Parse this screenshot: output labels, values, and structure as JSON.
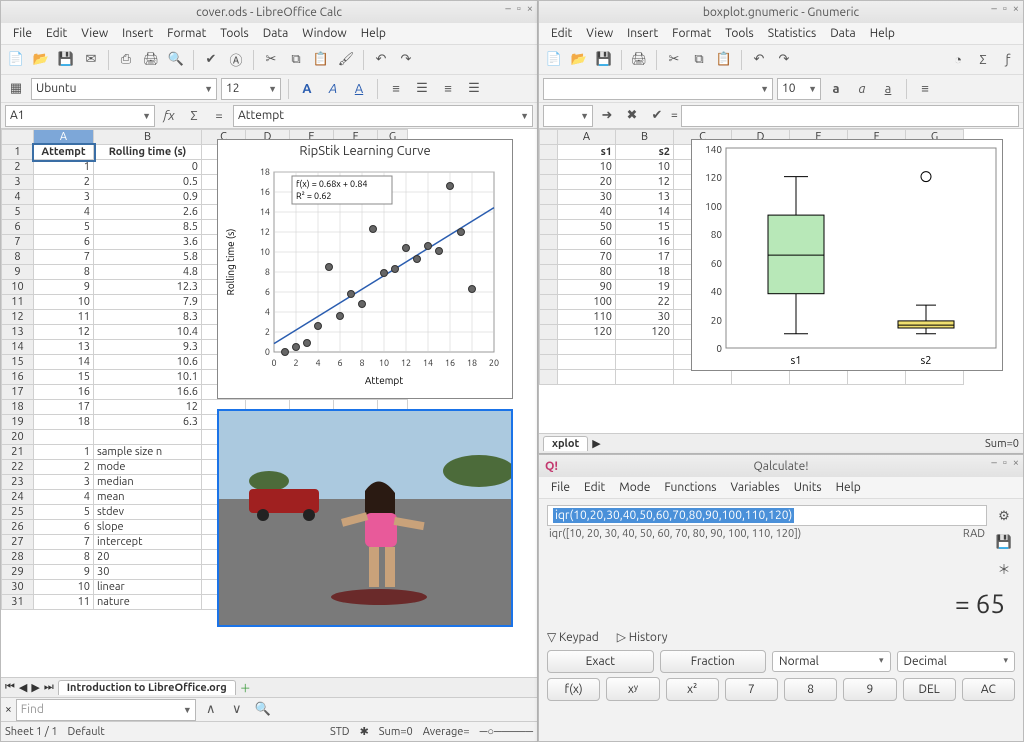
{
  "calc": {
    "title": "cover.ods - LibreOffice Calc",
    "menus": [
      "File",
      "Edit",
      "View",
      "Insert",
      "Format",
      "Tools",
      "Data",
      "Window",
      "Help"
    ],
    "font": "Ubuntu",
    "fontsize": "12",
    "cellref": "A1",
    "cellvalue": "Attempt",
    "cols": [
      "A",
      "B",
      "C",
      "D",
      "E",
      "F",
      "G"
    ],
    "headers": {
      "A": "Attempt",
      "B": "Rolling time (s)"
    },
    "rows": [
      {
        "n": 1,
        "a": "Attempt",
        "b": "Rolling time (s)"
      },
      {
        "n": 2,
        "a": "1",
        "b": "0"
      },
      {
        "n": 3,
        "a": "2",
        "b": "0.5"
      },
      {
        "n": 4,
        "a": "3",
        "b": "0.9"
      },
      {
        "n": 5,
        "a": "4",
        "b": "2.6"
      },
      {
        "n": 6,
        "a": "5",
        "b": "8.5"
      },
      {
        "n": 7,
        "a": "6",
        "b": "3.6"
      },
      {
        "n": 8,
        "a": "7",
        "b": "5.8"
      },
      {
        "n": 9,
        "a": "8",
        "b": "4.8"
      },
      {
        "n": 10,
        "a": "9",
        "b": "12.3"
      },
      {
        "n": 11,
        "a": "10",
        "b": "7.9"
      },
      {
        "n": 12,
        "a": "11",
        "b": "8.3"
      },
      {
        "n": 13,
        "a": "12",
        "b": "10.4"
      },
      {
        "n": 14,
        "a": "13",
        "b": "9.3"
      },
      {
        "n": 15,
        "a": "14",
        "b": "10.6"
      },
      {
        "n": 16,
        "a": "15",
        "b": "10.1"
      },
      {
        "n": 17,
        "a": "16",
        "b": "16.6"
      },
      {
        "n": 18,
        "a": "17",
        "b": "12"
      },
      {
        "n": 19,
        "a": "18",
        "b": "6.3"
      },
      {
        "n": 20,
        "a": "",
        "b": ""
      },
      {
        "n": 21,
        "a": "1",
        "b": "sample size n"
      },
      {
        "n": 22,
        "a": "2",
        "b": "mode"
      },
      {
        "n": 23,
        "a": "3",
        "b": "median"
      },
      {
        "n": 24,
        "a": "4",
        "b": "mean"
      },
      {
        "n": 25,
        "a": "5",
        "b": "stdev"
      },
      {
        "n": 26,
        "a": "6",
        "b": "slope"
      },
      {
        "n": 27,
        "a": "7",
        "b": "intercept"
      },
      {
        "n": 28,
        "a": "8",
        "b": "20"
      },
      {
        "n": 29,
        "a": "9",
        "b": "30"
      },
      {
        "n": 30,
        "a": "10",
        "b": "linear"
      },
      {
        "n": 31,
        "a": "11",
        "b": "nature"
      }
    ],
    "chart": {
      "title": "RipStik Learning Curve",
      "eq1": "f(x) = 0.68x + 0.84",
      "eq2": "R² = 0.62",
      "xlabel": "Attempt",
      "ylabel": "Rolling time (s)"
    },
    "sheet_tab": "Introduction to LibreOffice.org",
    "find_placeholder": "Find",
    "status": {
      "sheet": "Sheet 1 / 1",
      "style": "Default",
      "mode": "STD",
      "sum_label": "Sum=0",
      "avg_label": "Average="
    }
  },
  "gnumeric": {
    "title": "boxplot.gnumeric - Gnumeric",
    "menus": [
      "Edit",
      "View",
      "Insert",
      "Format",
      "Tools",
      "Statistics",
      "Data",
      "Help"
    ],
    "fontsize": "10",
    "cols": [
      "A",
      "B",
      "C",
      "D",
      "E",
      "F",
      "G"
    ],
    "hdr": {
      "A": "s1",
      "B": "s2"
    },
    "data": [
      [
        "10",
        "10"
      ],
      [
        "20",
        "12"
      ],
      [
        "30",
        "13"
      ],
      [
        "40",
        "14"
      ],
      [
        "50",
        "15"
      ],
      [
        "60",
        "16"
      ],
      [
        "70",
        "17"
      ],
      [
        "80",
        "18"
      ],
      [
        "90",
        "19"
      ],
      [
        "100",
        "22"
      ],
      [
        "110",
        "30"
      ],
      [
        "120",
        "120"
      ]
    ],
    "tab": "xplot",
    "status_sum": "Sum=0"
  },
  "qalc": {
    "title": "Qalculate!",
    "menus": [
      "File",
      "Edit",
      "Mode",
      "Functions",
      "Variables",
      "Units",
      "Help"
    ],
    "input": "iqr(10,20,30,40,50,60,70,80,90,100,110,120)",
    "echo": "iqr([10, 20, 30, 40, 50, 60, 70, 80, 90, 100, 110, 120])",
    "rad": "RAD",
    "result": "= 65",
    "keypad": "Keypad",
    "history": "History",
    "btns1": [
      "Exact",
      "Fraction"
    ],
    "sel1": "Normal",
    "sel2": "Decimal",
    "btns2": [
      "f(x)",
      "xʸ",
      "x²",
      "7",
      "8",
      "9",
      "DEL",
      "AC"
    ]
  },
  "chart_data": [
    {
      "type": "scatter",
      "title": "RipStik Learning Curve",
      "xlabel": "Attempt",
      "ylabel": "Rolling time (s)",
      "xlim": [
        0,
        20
      ],
      "ylim": [
        0,
        18
      ],
      "xticks": [
        0,
        2,
        4,
        6,
        8,
        10,
        12,
        14,
        16,
        18,
        20
      ],
      "yticks": [
        0,
        2,
        4,
        6,
        8,
        10,
        12,
        14,
        16,
        18
      ],
      "series": [
        {
          "name": "points",
          "x": [
            1,
            2,
            3,
            4,
            5,
            6,
            7,
            8,
            9,
            10,
            11,
            12,
            13,
            14,
            15,
            16,
            17,
            18
          ],
          "y": [
            0,
            0.5,
            0.9,
            2.6,
            8.5,
            3.6,
            5.8,
            4.8,
            12.3,
            7.9,
            8.3,
            10.4,
            9.3,
            10.6,
            10.1,
            16.6,
            12,
            6.3
          ]
        }
      ],
      "trendline": {
        "slope": 0.68,
        "intercept": 0.84,
        "r2": 0.62
      },
      "annotations": [
        "f(x) = 0.68x + 0.84",
        "R² = 0.62"
      ]
    },
    {
      "type": "boxplot",
      "title": "",
      "ylabel": "",
      "ylim": [
        0,
        140
      ],
      "yticks": [
        0,
        20,
        40,
        60,
        80,
        100,
        120,
        140
      ],
      "categories": [
        "s1",
        "s2"
      ],
      "series": [
        {
          "name": "s1",
          "min": 10,
          "q1": 38,
          "median": 65,
          "q3": 93,
          "max": 120,
          "outliers": []
        },
        {
          "name": "s2",
          "min": 10,
          "q1": 14,
          "median": 16,
          "q3": 19,
          "max": 30,
          "outliers": [
            120
          ]
        }
      ]
    }
  ]
}
